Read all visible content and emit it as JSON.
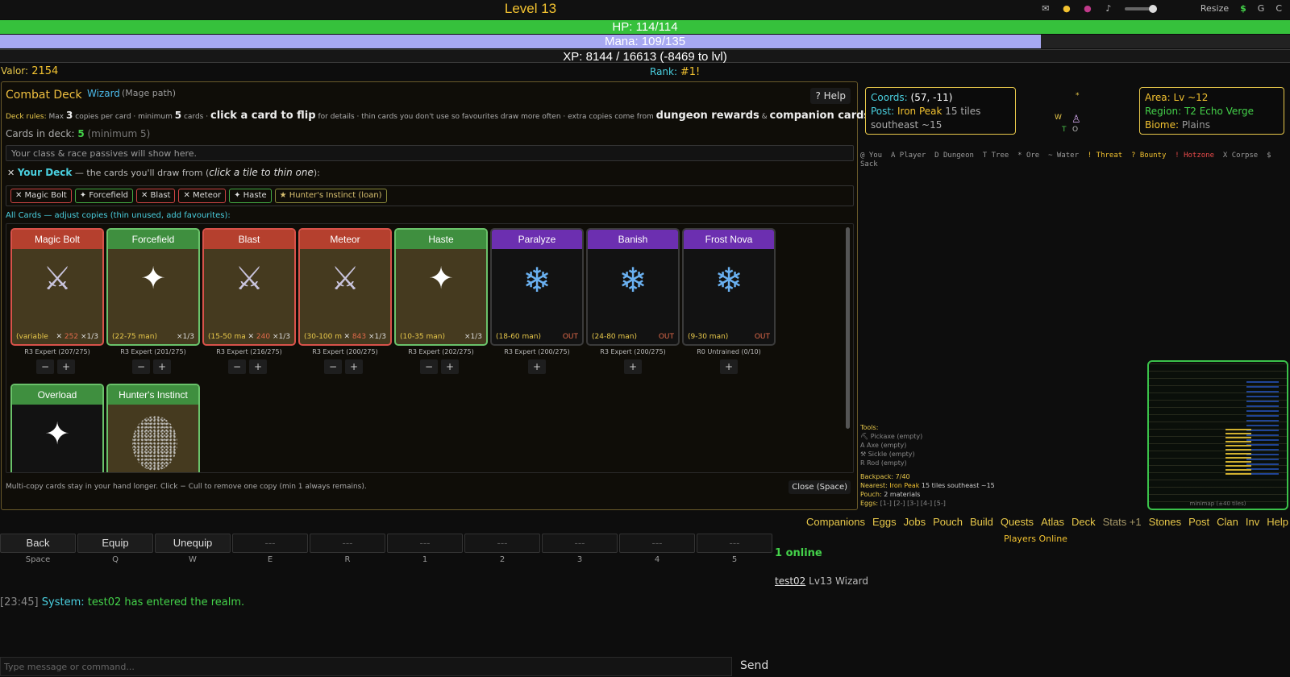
{
  "top": {
    "level": "Level 13",
    "resize": "Resize",
    "currency": [
      "$",
      "G",
      "C"
    ]
  },
  "bars": {
    "hp": "HP: 114/114",
    "hp_fraction": 1.0,
    "mana": "Mana: 109/135",
    "mana_fraction": 0.807,
    "xp": "XP: 8144 / 16613 (-8469 to lvl)"
  },
  "valor": {
    "label": "Valor:",
    "value": "2154"
  },
  "rank": {
    "label": "Rank:",
    "value": "#1!"
  },
  "deck": {
    "title": "Combat Deck",
    "class": "Wizard",
    "path": "(Mage path)",
    "help": "? Help",
    "rules": {
      "label": "Deck rules:",
      "max_pre": "Max",
      "max_n": "3",
      "max_post": "copies per card",
      "min_pre": "minimum",
      "min_n": "5",
      "min_post": "cards",
      "flip": "click a card to flip",
      "flip_post": "for details",
      "thin": "thin cards you don't use so favourites draw more often",
      "extra": "extra copies come from",
      "dungeon": "dungeon rewards",
      "amp": "&",
      "companion": "companion cards",
      "end": "."
    },
    "count_label": "Cards in deck:",
    "count_value": "5",
    "count_min": "(minimum 5)",
    "passives": "Your class & race passives will show here.",
    "your_deck_title": "Your Deck",
    "your_deck_desc": "— the cards you'll draw from (",
    "your_deck_hint": "click a tile to thin one",
    "your_deck_end": "):",
    "chips": [
      "✕ Magic Bolt",
      "✦ Forcefield",
      "✕ Blast",
      "✕ Meteor",
      "✦ Haste",
      "★ Hunter's Instinct (loan)"
    ],
    "all_cards_label": "All Cards — adjust copies (thin unused, add favourites):",
    "cards": [
      {
        "name": "Magic Bolt",
        "range": "(variable",
        "power": "252",
        "copies": "×1/3",
        "rank": "R3 Expert (207/275)"
      },
      {
        "name": "Forcefield",
        "range": "(22-75 man)",
        "copies": "×1/3",
        "rank": "R3 Expert (201/275)"
      },
      {
        "name": "Blast",
        "range": "(15-50 ma",
        "power": "240",
        "copies": "×1/3",
        "rank": "R3 Expert (216/275)"
      },
      {
        "name": "Meteor",
        "range": "(30-100 m",
        "power": "843",
        "copies": "×1/3",
        "rank": "R3 Expert (200/275)"
      },
      {
        "name": "Haste",
        "range": "(10-35 man)",
        "copies": "×1/3",
        "rank": "R3 Expert (202/275)"
      },
      {
        "name": "Paralyze",
        "range": "(18-60 man)",
        "status": "OUT",
        "rank": "R3 Expert (200/275)"
      },
      {
        "name": "Banish",
        "range": "(24-80 man)",
        "status": "OUT",
        "rank": "R3 Expert (200/275)"
      },
      {
        "name": "Frost Nova",
        "range": "(9-30 man)",
        "status": "OUT",
        "rank": "R0 Untrained (0/10)"
      },
      {
        "name": "Overload"
      },
      {
        "name": "Hunter's Instinct"
      }
    ],
    "note": "Multi-copy cards stay in your hand longer. Click − Cull to remove one copy (min 1 always remains).",
    "close": "Close (Space)"
  },
  "location": {
    "coords_label": "Coords:",
    "coords": "(57, -11)",
    "post_label": "Post:",
    "post_name": "Iron Peak",
    "post_dist": "15 tiles",
    "post_dir": "southeast ~15",
    "area": "Area: Lv ~12",
    "region": "Region: T2 Echo Verge",
    "biome_label": "Biome:",
    "biome": "Plains"
  },
  "compass": {
    "w": "W",
    "t": "T",
    "o": "O",
    "star": "*"
  },
  "legend": [
    "@ You",
    "A Player",
    "D Dungeon",
    "T Tree",
    "* Ore",
    "~ Water",
    "! Threat",
    "? Bounty",
    "! Hotzone",
    "X Corpse",
    "$ Sack"
  ],
  "tools": {
    "title": "Tools:",
    "items": [
      "⛏ Pickaxe (empty)",
      "A Axe (empty)",
      "⚒ Sickle (empty)",
      "R Rod (empty)"
    ],
    "backpack": "Backpack: 7/40",
    "nearest_label": "Nearest:",
    "nearest": "Iron Peak",
    "nearest_rest": "15 tiles southeast ~15",
    "pouch_label": "Pouch:",
    "pouch": "2 materials",
    "eggs_label": "Eggs:",
    "eggs": "[1-] [2-] [3-] [4-] [5-]"
  },
  "minimap_caption": "minimap (±40 tiles)",
  "menu": [
    "Companions",
    "Eggs",
    "Jobs",
    "Pouch",
    "Build",
    "Quests",
    "Atlas",
    "Deck",
    "Stats +1",
    "Stones",
    "Post",
    "Clan",
    "Inv",
    "Help"
  ],
  "players_online_label": "Players Online",
  "actions": [
    {
      "label": "Back",
      "key": "Space"
    },
    {
      "label": "Equip",
      "key": "Q"
    },
    {
      "label": "Unequip",
      "key": "W"
    },
    {
      "label": "---",
      "key": "E"
    },
    {
      "label": "---",
      "key": "R"
    },
    {
      "label": "---",
      "key": "1"
    },
    {
      "label": "---",
      "key": "2"
    },
    {
      "label": "---",
      "key": "3"
    },
    {
      "label": "---",
      "key": "4"
    },
    {
      "label": "---",
      "key": "5"
    }
  ],
  "online": "1 online",
  "player": {
    "name": "test02",
    "desc": "Lv13 Wizard"
  },
  "chat": {
    "time": "[23:45]",
    "sender": "System:",
    "message": "test02 has entered the realm.",
    "placeholder": "Type message or command...",
    "send": "Send"
  },
  "colors": {
    "accent": "#f2c230",
    "hp": "#36c13c",
    "mana": "#a7a8f2",
    "cyan": "#4ad0e0"
  }
}
